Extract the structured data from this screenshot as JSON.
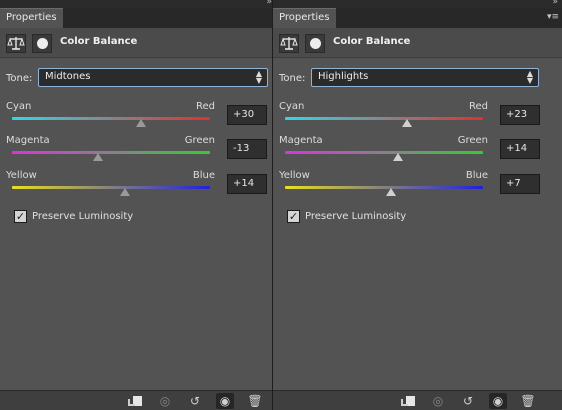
{
  "panels": [
    {
      "tab": "Properties",
      "title": "Color Balance",
      "tone_label": "Tone:",
      "tone_value": "Midtones",
      "sliders": [
        {
          "left": "Cyan",
          "right": "Red",
          "value": "+30",
          "level": 0.65
        },
        {
          "left": "Magenta",
          "right": "Green",
          "value": "-13",
          "level": 0.435
        },
        {
          "left": "Yellow",
          "right": "Blue",
          "value": "+14",
          "level": 0.57
        }
      ],
      "preserve_label": "Preserve Luminosity",
      "preserve_checked": true
    },
    {
      "tab": "Properties",
      "title": "Color Balance",
      "tone_label": "Tone:",
      "tone_value": "Highlights",
      "sliders": [
        {
          "left": "Cyan",
          "right": "Red",
          "value": "+23",
          "level": 0.615
        },
        {
          "left": "Magenta",
          "right": "Green",
          "value": "+14",
          "level": 0.57
        },
        {
          "left": "Yellow",
          "right": "Blue",
          "value": "+7",
          "level": 0.535
        }
      ],
      "preserve_label": "Preserve Luminosity",
      "preserve_checked": true
    }
  ],
  "colors": {
    "panel_bg": "#535353",
    "cyan_red": [
      "#2fd8e8",
      "#e03030"
    ],
    "magenta_green": [
      "#e030e0",
      "#30d030"
    ],
    "yellow_blue": [
      "#e8e020",
      "#2020e0"
    ]
  },
  "icons": {
    "collapse": "double-chevron-right-icon",
    "menu": "panel-menu-icon",
    "adjustment": "scale-balance-icon",
    "mask": "layer-mask-icon",
    "bottom": [
      "clip-to-layer-icon",
      "view-previous-state-icon",
      "reset-icon",
      "visibility-eye-icon",
      "trash-icon"
    ]
  }
}
